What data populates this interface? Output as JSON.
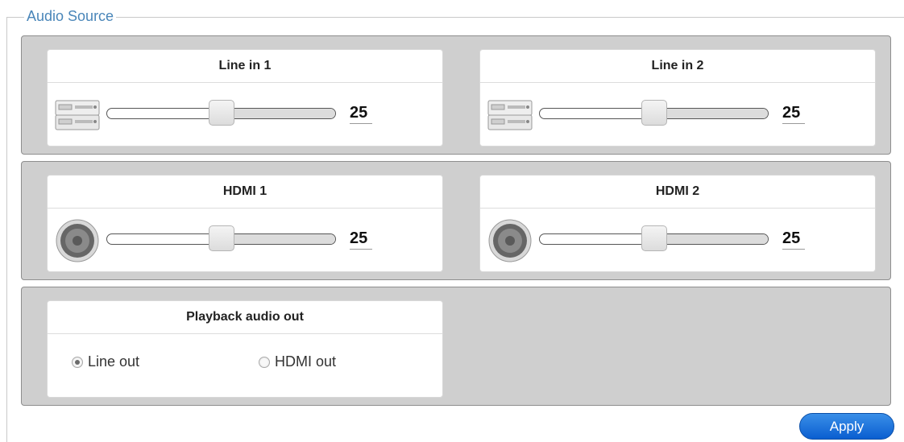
{
  "section": {
    "legend": "Audio Source"
  },
  "inputs": [
    {
      "title": "Line in 1",
      "icon": "audio-device-icon",
      "value": "25",
      "level": 0.5
    },
    {
      "title": "Line in 2",
      "icon": "audio-device-icon",
      "value": "25",
      "level": 0.5
    },
    {
      "title": "HDMI 1",
      "icon": "speaker-icon",
      "value": "25",
      "level": 0.5
    },
    {
      "title": "HDMI 2",
      "icon": "speaker-icon",
      "value": "25",
      "level": 0.5
    }
  ],
  "playback": {
    "title": "Playback audio out",
    "options": [
      {
        "label": "Line out",
        "selected": true
      },
      {
        "label": "HDMI out",
        "selected": false
      }
    ]
  },
  "actions": {
    "apply_label": "Apply"
  },
  "colors": {
    "legend": "#4a86b9",
    "apply_button": "#1a6fdc",
    "group_bg": "#cfcfcf"
  }
}
